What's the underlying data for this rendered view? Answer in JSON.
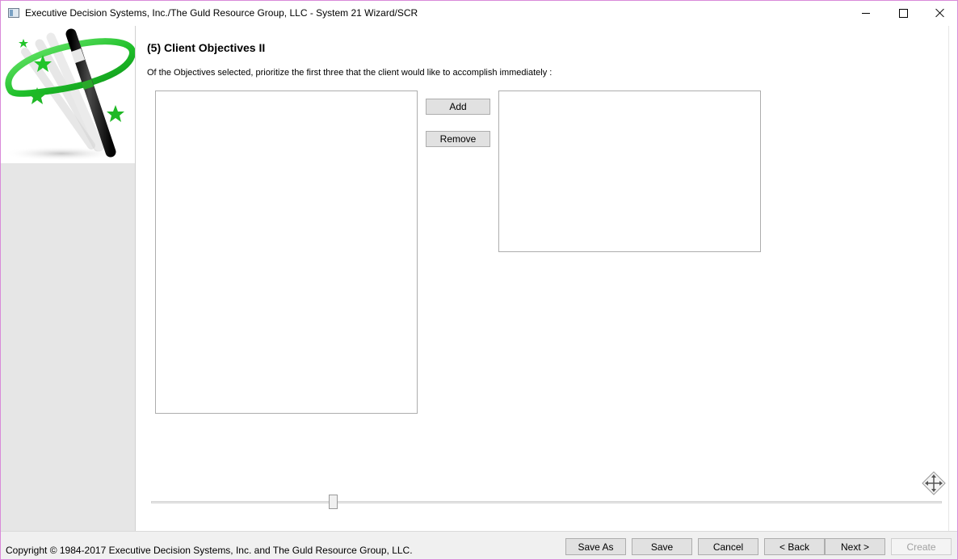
{
  "window": {
    "title": "Executive Decision Systems, Inc./The Guld Resource Group, LLC - System 21 Wizard/SCR",
    "icon": "app-window-icon",
    "controls": [
      "minimize-icon",
      "maximize-icon",
      "close-icon"
    ]
  },
  "sidebar": {
    "logo": "magic-wand-logo"
  },
  "main": {
    "page_title": "(5) Client Objectives II",
    "instructions": "Of the Objectives selected, prioritize the first three that the client would like to accomplish immediately :",
    "available_list": {
      "items": []
    },
    "selected_list": {
      "items": []
    },
    "add_label": "Add",
    "remove_label": "Remove",
    "move_icon": "move-arrows-icon",
    "slider": {
      "value": 0.22
    }
  },
  "footer": {
    "copyright": "Copyright © 1984-2017 Executive Decision Systems, Inc. and The Guld Resource Group, LLC.",
    "buttons": {
      "save_as": "Save As",
      "save": "Save",
      "cancel": "Cancel",
      "back": "< Back",
      "next": "Next >",
      "create": "Create"
    },
    "create_enabled": false
  },
  "colors": {
    "window_border": "#d98ad9",
    "logo_green": "#22b84a",
    "button_face": "#e1e1e1",
    "sidebar_gray": "#e6e6e6"
  }
}
